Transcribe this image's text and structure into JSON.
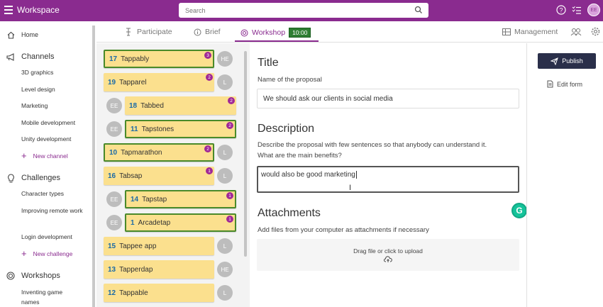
{
  "topbar": {
    "title": "Workspace",
    "search_placeholder": "Search",
    "avatar": "EE"
  },
  "sidebar": {
    "home": "Home",
    "channels": {
      "label": "Channels",
      "items": [
        "3D graphics",
        "Level design",
        "Marketing",
        "Mobile development",
        "Unity development"
      ],
      "new": "New channel"
    },
    "challenges": {
      "label": "Challenges",
      "items": [
        "Character types",
        "Improving remote work",
        "Login development"
      ],
      "new": "New challenge"
    },
    "workshops": {
      "label": "Workshops",
      "items": [
        "Inventing game names"
      ]
    }
  },
  "tabs": {
    "participate": "Participate",
    "brief": "Brief",
    "workshop": "Workshop",
    "timer": "10:00",
    "management": "Management"
  },
  "cards": [
    {
      "num": "17",
      "name": "Tappably",
      "badge": "3",
      "owner": "HE",
      "sel": true
    },
    {
      "num": "19",
      "name": "Tapparel",
      "badge": "2",
      "owner": "L",
      "sel": false
    },
    {
      "num": "18",
      "name": "Tabbed",
      "badge": "2",
      "owner": "EE",
      "sel": false,
      "left": true
    },
    {
      "num": "11",
      "name": "Tapstones",
      "badge": "2",
      "owner": "EE",
      "sel": true,
      "left": true
    },
    {
      "num": "10",
      "name": "Tapmarathon",
      "badge": "2",
      "owner": "L",
      "sel": true
    },
    {
      "num": "16",
      "name": "Tabsap",
      "badge": "1",
      "owner": "L",
      "sel": false
    },
    {
      "num": "14",
      "name": "Tapstap",
      "badge": "1",
      "owner": "EE",
      "sel": true,
      "left": true
    },
    {
      "num": "1",
      "name": "Arcadetap",
      "badge": "1",
      "owner": "EE",
      "sel": true,
      "left": true
    },
    {
      "num": "15",
      "name": "Tappee app",
      "badge": "",
      "owner": "L",
      "sel": false
    },
    {
      "num": "13",
      "name": "Tapperdap",
      "badge": "",
      "owner": "HE",
      "sel": false
    },
    {
      "num": "12",
      "name": "Tappable",
      "badge": "",
      "owner": "L",
      "sel": false
    }
  ],
  "form": {
    "title_heading": "Title",
    "title_label": "Name of the proposal",
    "title_value": "We should ask our clients in social media",
    "desc_heading": "Description",
    "desc_label_1": "Describe the proposal with few sentences so that anybody can understand it.",
    "desc_label_2": "What are the main benefits?",
    "desc_value": "would also be good marketing",
    "att_heading": "Attachments",
    "att_label": "Add files from your computer as attachments if necessary",
    "drop_text": "Drag file or click to upload"
  },
  "actions": {
    "publish": "Publish",
    "edit_form": "Edit form"
  },
  "colors": {
    "brand": "#8a2b8f",
    "card": "#fbe08e",
    "selected_border": "#4a8a2a",
    "publish_bg": "#2a2f4a"
  }
}
